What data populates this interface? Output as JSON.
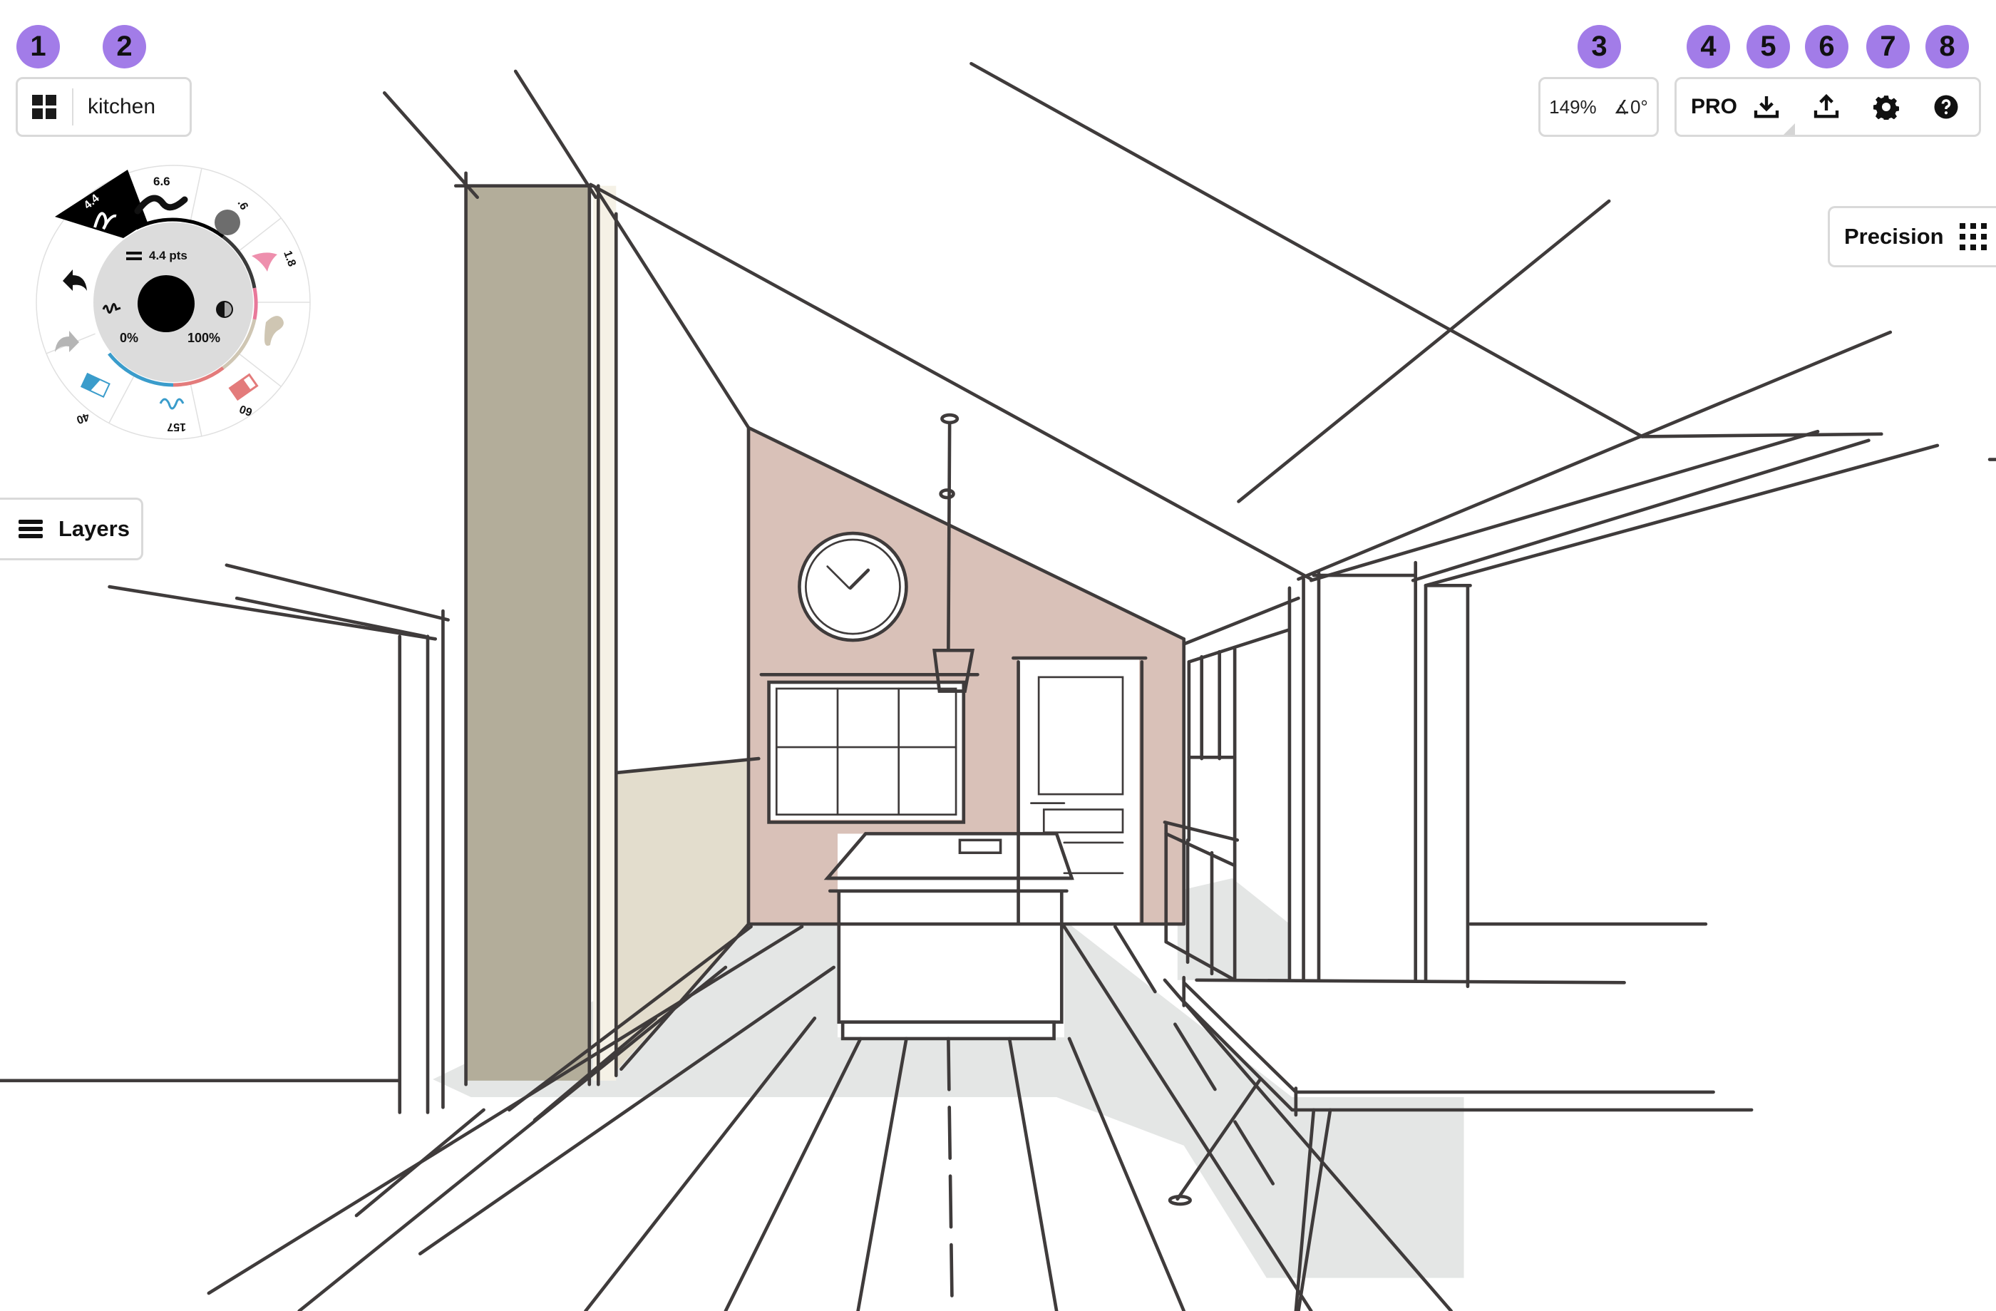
{
  "app": {
    "document_title": "kitchen",
    "gallery_icon": "grid-icon"
  },
  "badges": [
    "1",
    "2",
    "3",
    "4",
    "5",
    "6",
    "7",
    "8"
  ],
  "view_status": {
    "zoom": "149%",
    "rotation": "∡0°"
  },
  "toolbar": {
    "pro_label": "PRO",
    "items": [
      {
        "name": "import",
        "icon": "download-icon"
      },
      {
        "name": "export",
        "icon": "upload-icon"
      },
      {
        "name": "settings",
        "icon": "gear-icon"
      },
      {
        "name": "help",
        "icon": "help-icon"
      }
    ]
  },
  "precision": {
    "label": "Precision",
    "icon": "grid-dots-icon"
  },
  "layers": {
    "label": "Layers",
    "icon": "layers-icon"
  },
  "tool_wheel": {
    "center": {
      "size_label": "4.4 pts",
      "smoothing": "0%",
      "opacity": "100%",
      "current_color": "#000000"
    },
    "tools": [
      {
        "name": "pen",
        "value": "4.4",
        "selected": true
      },
      {
        "name": "brush",
        "value": "6.6"
      },
      {
        "name": "pencil",
        "value": ".6"
      },
      {
        "name": "airbrush",
        "value": "1.8",
        "color": "#e8789a"
      },
      {
        "name": "marker",
        "value": "",
        "color": "#cfc6b3"
      },
      {
        "name": "eraser",
        "value": "60",
        "color": "#e37b7b"
      },
      {
        "name": "wire",
        "value": "157",
        "color": "#3a9ccb"
      },
      {
        "name": "fill-eraser",
        "value": "40",
        "color": "#3a9ccb"
      }
    ],
    "undo": "undo-icon",
    "redo": "redo-icon"
  },
  "colors": {
    "badge": "#a27ce8",
    "line": "#3f3b3b",
    "pink_wall": "#d9c1b8",
    "taupe_column": "#b3ad9a",
    "beige_wall": "#e3ddcd",
    "shadow": "#e4e6e5"
  }
}
